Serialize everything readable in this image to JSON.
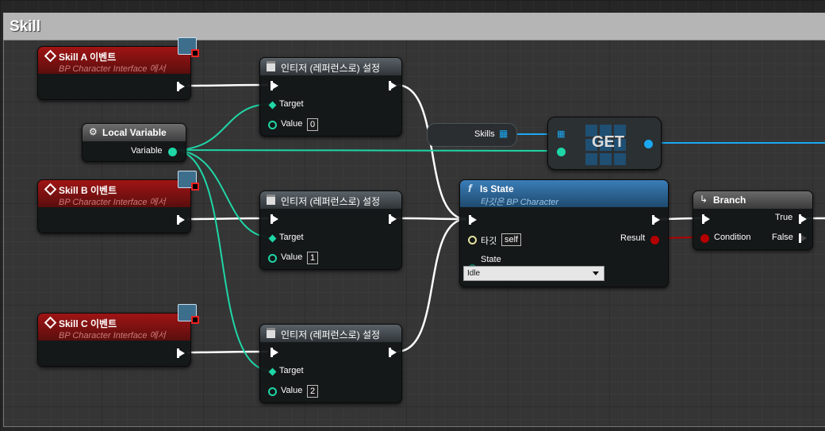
{
  "comment": {
    "title": "Skill"
  },
  "events": [
    {
      "title": "Skill A 이벤트",
      "subtitle": "BP Character Interface 에서"
    },
    {
      "title": "Skill B 이벤트",
      "subtitle": "BP Character Interface 에서"
    },
    {
      "title": "Skill C 이벤트",
      "subtitle": "BP Character Interface 에서"
    }
  ],
  "local_var": {
    "title": "Local Variable",
    "pin": "Variable"
  },
  "setters": [
    {
      "title": "인티저 (레퍼런스로) 설정",
      "target": "Target",
      "value_label": "Value",
      "value": "0"
    },
    {
      "title": "인티저 (레퍼런스로) 설정",
      "target": "Target",
      "value_label": "Value",
      "value": "1"
    },
    {
      "title": "인티저 (레퍼런스로) 설정",
      "target": "Target",
      "value_label": "Value",
      "value": "2"
    }
  ],
  "skills_var": {
    "label": "Skills"
  },
  "get_node": {
    "label": "GET"
  },
  "is_state": {
    "title": "Is State",
    "subtitle": "타깃은 BP Character",
    "target_label": "타깃",
    "target_value": "self",
    "result_label": "Result",
    "state_label": "State",
    "state_value": "Idle"
  },
  "branch": {
    "title": "Branch",
    "condition": "Condition",
    "true_label": "True",
    "false_label": "False"
  },
  "colors": {
    "exec": "#ffffff",
    "integer": "#1fd6a6",
    "bool": "#b40000",
    "object": "#1aa8f0",
    "event_header": "#a01414",
    "function_header": "#3b7db8"
  }
}
